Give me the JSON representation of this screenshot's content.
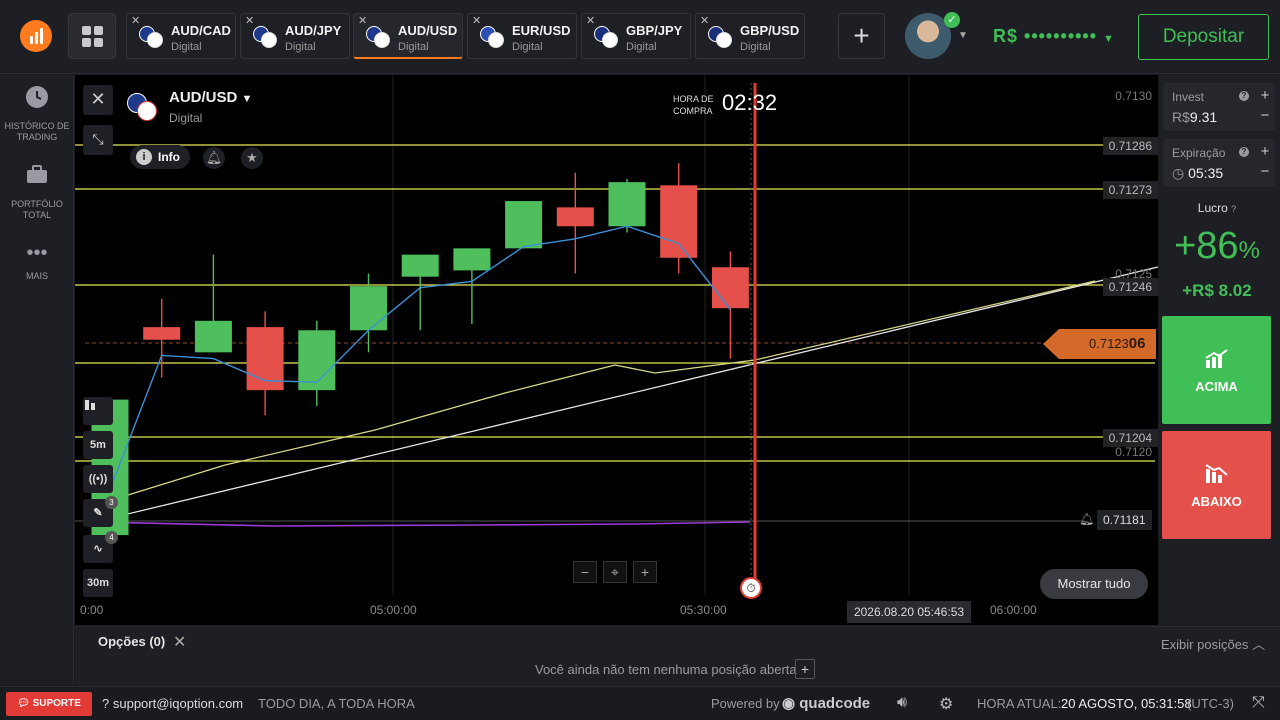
{
  "topbar": {
    "tabs": [
      {
        "pair": "AUD/CAD",
        "type": "Digital",
        "colorA": "#1d3a8a",
        "colorB": "#ffffff"
      },
      {
        "pair": "AUD/JPY",
        "type": "Digital",
        "colorA": "#1d3a8a",
        "colorB": "#ffffff"
      },
      {
        "pair": "AUD/USD",
        "type": "Digital",
        "colorA": "#1d3a8a",
        "colorB": "#ffffff",
        "active": true
      },
      {
        "pair": "EUR/USD",
        "type": "Digital",
        "colorA": "#2c4fb5",
        "colorB": "#ffffff"
      },
      {
        "pair": "GBP/JPY",
        "type": "Digital",
        "colorA": "#1a2f7a",
        "colorB": "#ffffff"
      },
      {
        "pair": "GBP/USD",
        "type": "Digital",
        "colorA": "#1a2f7a",
        "colorB": "#ffffff"
      }
    ],
    "add_tab": "+",
    "balance": "R$ ••••••••••",
    "deposit_label": "Depositar"
  },
  "sidebar": {
    "items": [
      {
        "label": "HISTÓRICO DE TRADING",
        "icon": "clock-icon"
      },
      {
        "label": "PORTFÓLIO TOTAL",
        "icon": "briefcase-icon"
      },
      {
        "label": "MAIS",
        "icon": "more-icon"
      }
    ]
  },
  "chart": {
    "asset": "AUD/USD",
    "asset_type": "Digital",
    "info_label": "Info",
    "purchase_label_line1": "HORA DE",
    "purchase_label_line2": "COMPRA",
    "purchase_countdown": "02:32",
    "current_price_prefix": "0.7123",
    "current_price_suffix": "06",
    "alarm_price": "0.71181",
    "show_all_label": "Mostrar tudo",
    "cursor_time": "2026.08.20 05:46:53",
    "tool_5m": "5m",
    "tool_30m": "30m",
    "badge_draw": "3",
    "badge_indicator": "4",
    "time_ticks": [
      "0:00",
      "05:00:00",
      "05:30:00",
      "06:00:00"
    ],
    "levels": [
      "0.7130",
      "0.71286",
      "0.71273",
      "0.7125",
      "0.71246",
      "0.71204",
      "0.7120"
    ],
    "colors": {
      "up": "#4fbf5e",
      "down": "#e5504a",
      "ma": "#3d8fd6",
      "level": "#e8e85a",
      "expiry": "#e23a34"
    }
  },
  "chart_data": {
    "type": "candlestick",
    "candles": [
      {
        "o": 0.71164,
        "h": 0.71207,
        "l": 0.71164,
        "c": 0.71207
      },
      {
        "o": 0.7123,
        "h": 0.71239,
        "l": 0.71214,
        "c": 0.71226
      },
      {
        "o": 0.71222,
        "h": 0.71253,
        "l": 0.71222,
        "c": 0.71232
      },
      {
        "o": 0.7123,
        "h": 0.71235,
        "l": 0.71202,
        "c": 0.7121
      },
      {
        "o": 0.7121,
        "h": 0.71232,
        "l": 0.71205,
        "c": 0.71229
      },
      {
        "o": 0.71229,
        "h": 0.71247,
        "l": 0.71222,
        "c": 0.71243
      },
      {
        "o": 0.71246,
        "h": 0.71247,
        "l": 0.71229,
        "c": 0.71253
      },
      {
        "o": 0.71248,
        "h": 0.7125,
        "l": 0.71231,
        "c": 0.71255
      },
      {
        "o": 0.71255,
        "h": 0.71265,
        "l": 0.71255,
        "c": 0.7127
      },
      {
        "o": 0.71268,
        "h": 0.71279,
        "l": 0.71247,
        "c": 0.71262
      },
      {
        "o": 0.71262,
        "h": 0.71277,
        "l": 0.7126,
        "c": 0.71276
      },
      {
        "o": 0.71275,
        "h": 0.71282,
        "l": 0.71247,
        "c": 0.71252
      },
      {
        "o": 0.71249,
        "h": 0.71254,
        "l": 0.7122,
        "c": 0.71236
      }
    ],
    "ylim": [
      0.71145,
      0.7131
    ],
    "xlabel": "",
    "ylabel": ""
  },
  "rightpanel": {
    "invest_label": "Invest",
    "invest_currency": "R$",
    "invest_value": "9.31",
    "expiry_label": "Expiração",
    "expiry_value": "05:35",
    "profit_label": "Lucro",
    "profit_pct": "+86",
    "profit_pct_sign": "%",
    "profit_amount": "+R$ 8.02",
    "up_label": "ACIMA",
    "down_label": "ABAIXO",
    "up_color": "#3fbf55",
    "down_color": "#e5504a"
  },
  "options": {
    "title": "Opções",
    "count": "(0)",
    "show_positions": "Exibir posições",
    "empty_text": "Você ainda não tem nenhuma posição aberta"
  },
  "statusbar": {
    "support": "SUPORTE",
    "email": "support@iqoption.com",
    "tagline": "TODO DIA, A TODA HORA",
    "powered": "Powered by",
    "quadcode": "quadcode",
    "time_label": "HORA ATUAL:",
    "time_value": "20 AGOSTO, 05:31:58",
    "timezone": "(UTC-3)"
  }
}
